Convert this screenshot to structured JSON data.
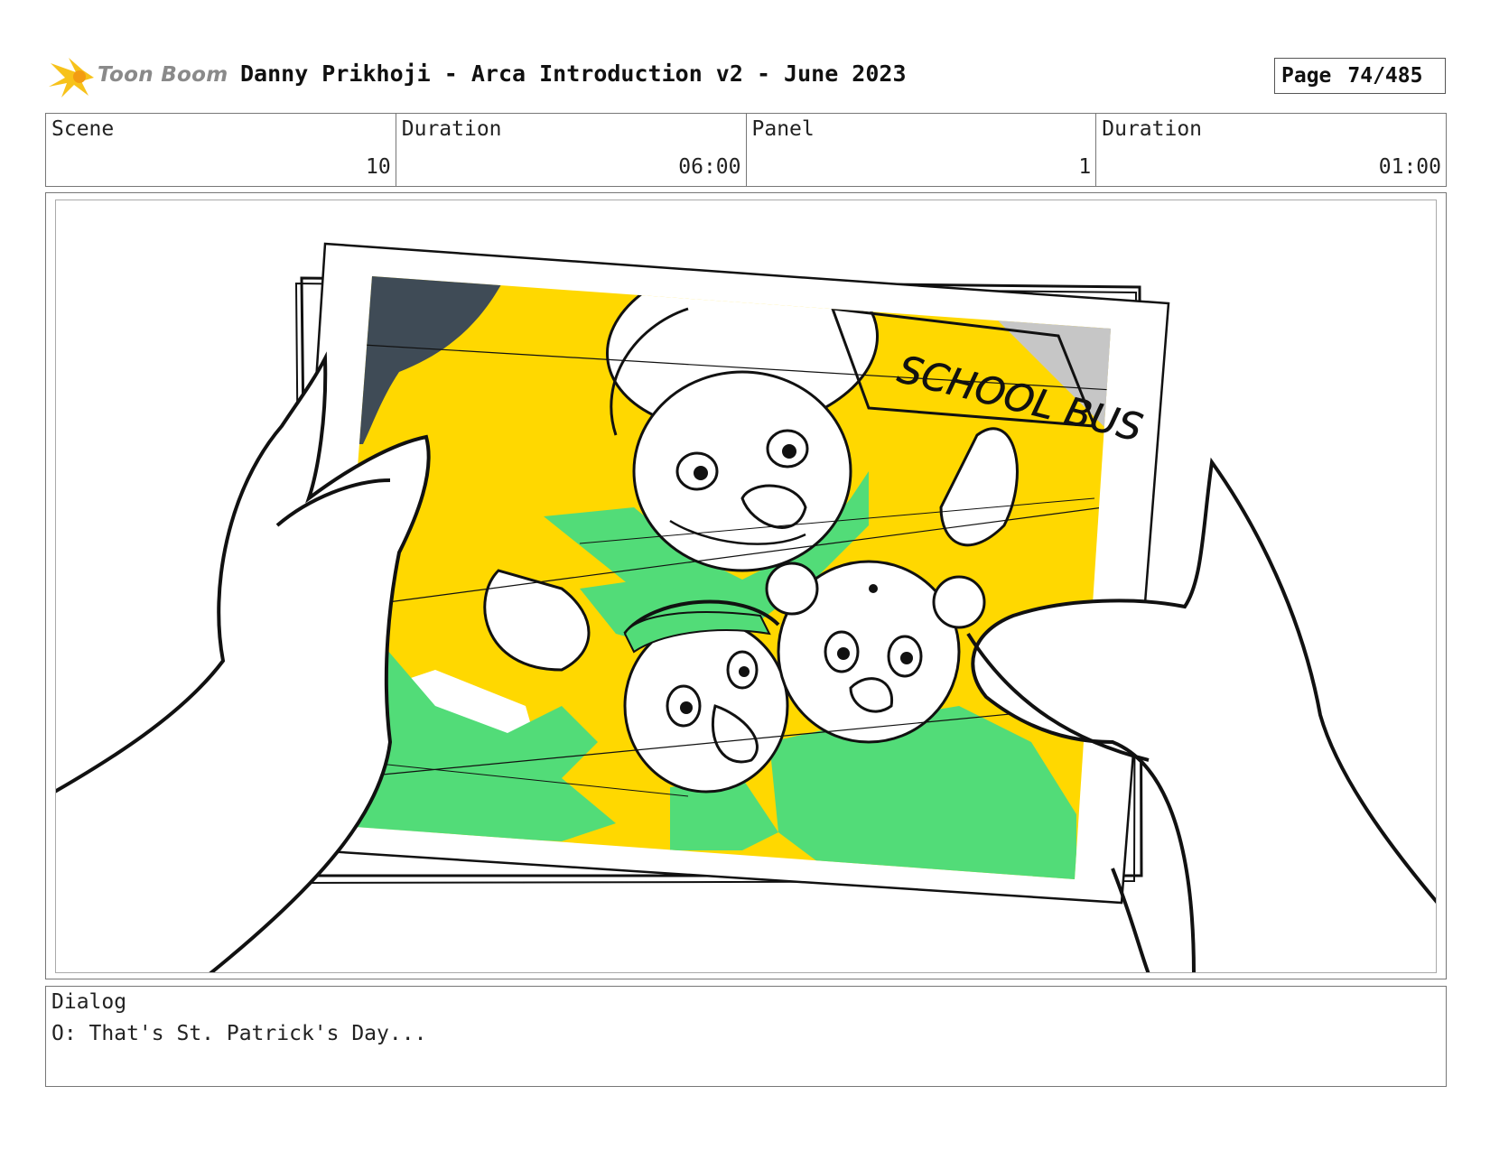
{
  "header": {
    "logo_text": "Toon Boom",
    "title": "Danny Prikhoji - Arca Introduction v2 - June 2023",
    "page_label": "Page",
    "page_value": "74/485"
  },
  "info": {
    "scene_label": "Scene",
    "scene_value": "10",
    "scene_duration_label": "Duration",
    "scene_duration_value": "06:00",
    "panel_label": "Panel",
    "panel_value": "1",
    "panel_duration_label": "Duration",
    "panel_duration_value": "01:00"
  },
  "panel": {
    "sign_text": "SCHOOL BUS",
    "colors": {
      "yellow": "#ffd800",
      "green": "#52dc78",
      "slate": "#3f4b56",
      "grey": "#c6c6c6"
    }
  },
  "dialog": {
    "label": "Dialog",
    "text": "O: That's St. Patrick's Day..."
  }
}
